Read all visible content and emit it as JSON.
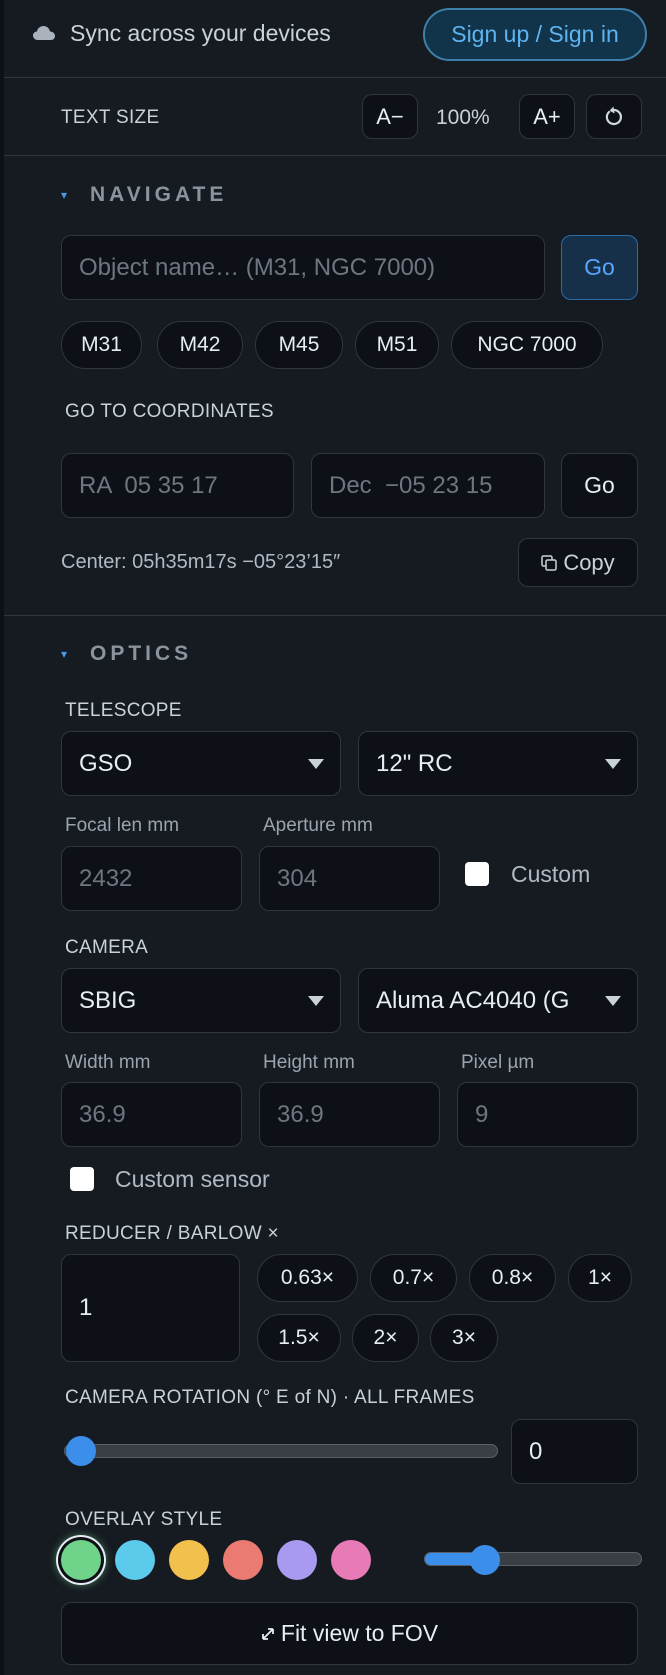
{
  "sync": {
    "icon": "cloud-icon",
    "text": "Sync across your devices",
    "signin_label": "Sign up / Sign in"
  },
  "text_size": {
    "label": "TEXT SIZE",
    "decrease_label": "A−",
    "value": "100%",
    "increase_label": "A+",
    "reset_icon": "reset-icon"
  },
  "navigate": {
    "title": "NAVIGATE",
    "object_placeholder": "Object name… (M31, NGC 7000)",
    "go_label": "Go",
    "quick_objects": [
      "M31",
      "M42",
      "M45",
      "M51",
      "NGC 7000"
    ],
    "coords_label": "GO TO COORDINATES",
    "ra_placeholder": "RA  05 35 17",
    "dec_placeholder": "Dec  −05 23 15",
    "coords_go_label": "Go",
    "center_text": "Center: 05h35m17s −05°23’15″",
    "copy_label": "Copy",
    "copy_icon": "copy-icon"
  },
  "optics": {
    "title": "OPTICS",
    "telescope_label": "TELESCOPE",
    "telescope_brand": "GSO",
    "telescope_model": "12\" RC",
    "focal_label": "Focal len mm",
    "focal_value": "2432",
    "aperture_label": "Aperture mm",
    "aperture_value": "304",
    "custom_label": "Custom",
    "camera_label": "CAMERA",
    "camera_brand": "SBIG",
    "camera_model": "Aluma AC4040 (G",
    "width_label": "Width mm",
    "width_value": "36.9",
    "height_label": "Height mm",
    "height_value": "36.9",
    "pixel_label": "Pixel µm",
    "pixel_value": "9",
    "custom_sensor_label": "Custom sensor",
    "reducer_label": "REDUCER / BARLOW ×",
    "reducer_value": "1",
    "reducer_presets": [
      "0.63×",
      "0.7×",
      "0.8×",
      "1×",
      "1.5×",
      "2×",
      "3×"
    ],
    "rotation_label": "CAMERA ROTATION (° E of N) · ALL FRAMES",
    "rotation_value": "0",
    "overlay_label": "OVERLAY STYLE",
    "overlay_colors": [
      "#6fd38a",
      "#5ccbeb",
      "#f2c04d",
      "#ea7a72",
      "#a79af0",
      "#e77bb8"
    ],
    "overlay_selected": 0,
    "overlay_opacity_fraction": 0.28,
    "fit_label": "Fit view to FOV",
    "fit_icon": "expand-icon"
  }
}
